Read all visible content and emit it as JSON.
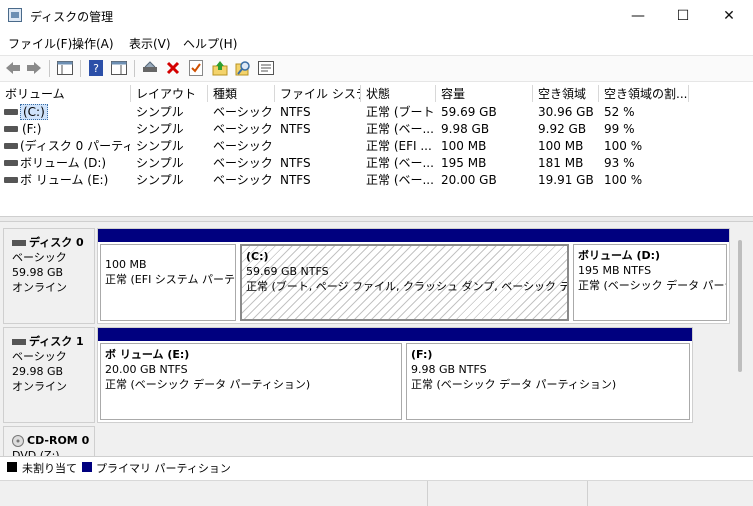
{
  "window": {
    "title": "ディスクの管理",
    "controls": {
      "minimize": "—",
      "maximize": "☐",
      "close": "✕"
    }
  },
  "menu": [
    "ファイル(F)",
    "操作(A)",
    "表示(V)",
    "ヘルプ(H)"
  ],
  "toolbar": {
    "icons": [
      "back-icon",
      "forward-icon",
      "console-tree-icon",
      "help-icon",
      "action-pane-icon",
      "connect-drive-icon",
      "delete-icon",
      "properties-check-icon",
      "refresh-up-icon",
      "search-icon",
      "settings-icon"
    ]
  },
  "volume_table": {
    "columns": [
      "ボリューム",
      "レイアウト",
      "種類",
      "ファイル システム",
      "状態",
      "容量",
      "空き領域",
      "空き領域の割..."
    ],
    "rows": [
      {
        "volume": "(C:)",
        "layout": "シンプル",
        "type": "ベーシック",
        "fs": "NTFS",
        "status": "正常 (ブート...",
        "capacity": "59.69 GB",
        "free": "30.96 GB",
        "pct": "52 %"
      },
      {
        "volume": "(F:)",
        "layout": "シンプル",
        "type": "ベーシック",
        "fs": "NTFS",
        "status": "正常 (ベー...",
        "capacity": "9.98 GB",
        "free": "9.92 GB",
        "pct": "99 %"
      },
      {
        "volume": "(ディスク 0 パーティシ...",
        "layout": "シンプル",
        "type": "ベーシック",
        "fs": "",
        "status": "正常 (EFI ...",
        "capacity": "100 MB",
        "free": "100 MB",
        "pct": "100 %"
      },
      {
        "volume": "ボリューム (D:)",
        "layout": "シンプル",
        "type": "ベーシック",
        "fs": "NTFS",
        "status": "正常 (ベー...",
        "capacity": "195 MB",
        "free": "181 MB",
        "pct": "93 %"
      },
      {
        "volume": "ボ リューム (E:)",
        "layout": "シンプル",
        "type": "ベーシック",
        "fs": "NTFS",
        "status": "正常 (ベー...",
        "capacity": "20.00 GB",
        "free": "19.91 GB",
        "pct": "100 %"
      }
    ]
  },
  "disks": [
    {
      "name": "ディスク 0",
      "kind": "ベーシック",
      "size": "59.98 GB",
      "state": "オンライン",
      "partitions": [
        {
          "name": "",
          "size": "100 MB",
          "status": "正常 (EFI システム パーティ"
        },
        {
          "name": "(C:)",
          "size": "59.69 GB NTFS",
          "status": "正常 (ブート, ページ ファイル, クラッシュ ダンプ, ベーシック データ パーテ"
        },
        {
          "name": "ボリューム  (D:)",
          "size": "195 MB NTFS",
          "status": "正常 (ベーシック データ パーティ"
        }
      ]
    },
    {
      "name": "ディスク 1",
      "kind": "ベーシック",
      "size": "29.98 GB",
      "state": "オンライン",
      "partitions": [
        {
          "name": "ボ リューム  (E:)",
          "size": "20.00 GB NTFS",
          "status": "正常 (ベーシック データ パーティション)"
        },
        {
          "name": "(F:)",
          "size": "9.98 GB NTFS",
          "status": "正常 (ベーシック データ パーティション)"
        }
      ]
    },
    {
      "name": "CD-ROM 0",
      "kind": "DVD (Z:)"
    }
  ],
  "legend": [
    {
      "label": "未割り当て",
      "color": "#000000"
    },
    {
      "label": "プライマリ パーティション",
      "color": "#00007f"
    }
  ],
  "colors": {
    "partition_header": "#00007f",
    "selection": "#cfe3fb"
  }
}
